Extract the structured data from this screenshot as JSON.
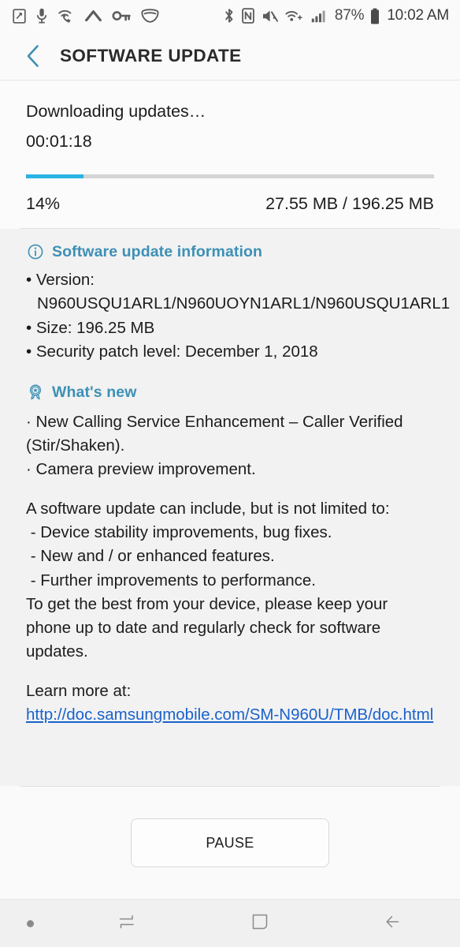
{
  "status_bar": {
    "left_icons": [
      {
        "name": "screenshot-capture-icon"
      },
      {
        "name": "microphone-recording-icon"
      },
      {
        "name": "wifi-calling-icon"
      },
      {
        "name": "caret-up-icon"
      },
      {
        "name": "vpn-key-icon"
      },
      {
        "name": "secure-shield-icon"
      }
    ],
    "right_icons": [
      {
        "name": "bluetooth-icon"
      },
      {
        "name": "nfc-icon"
      },
      {
        "name": "sound-mute-icon"
      },
      {
        "name": "wifi-icon"
      },
      {
        "name": "cellular-signal-icon"
      }
    ],
    "battery_percent": "87%",
    "battery_icon": "battery-full-icon",
    "clock": "10:02 AM"
  },
  "header": {
    "back_icon": "back-chevron-icon",
    "title": "SOFTWARE UPDATE",
    "accent_color": "#3d90b5"
  },
  "progress": {
    "status_text": "Downloading updates…",
    "elapsed_time": "00:01:18",
    "percent_label": "14%",
    "percent_value": 14,
    "bytes_label": "27.55 MB / 196.25 MB",
    "downloaded": "27.55 MB",
    "total": "196.25 MB",
    "fill_color": "#29b4e4",
    "track_color": "#d4d4d4"
  },
  "update_info": {
    "icon": "info-circle-icon",
    "heading": "Software update information",
    "items": [
      "• Version: N960USQU1ARL1/N960UOYN1ARL1/N960USQU1ARL1",
      "• Size: 196.25 MB",
      "• Security patch level: December 1, 2018"
    ],
    "version": "N960USQU1ARL1/N960UOYN1ARL1/N960USQU1ARL1",
    "size": "196.25 MB",
    "security_patch_level": "December 1, 2018"
  },
  "whats_new": {
    "icon": "award-badge-icon",
    "heading": "What's new",
    "highlights": "· New Calling Service Enhancement – Caller Verified (Stir/Shaken).\n· Camera preview improvement.",
    "description": "A software update can include, but is not limited to:\n - Device stability improvements, bug fixes.\n - New and / or enhanced features.\n - Further improvements to performance.\nTo get the best from your device, please keep your phone up to date and regularly check for software updates.",
    "learn_more_label": "Learn more at:",
    "learn_more_url": "http://doc.samsungmobile.com/SM-N960U/TMB/doc.html",
    "link_color": "#1a62cc"
  },
  "actions": {
    "pause_label": "PAUSE"
  },
  "nav_bar": {
    "dot_icon": "notification-dot-icon",
    "recents_icon": "recents-icon",
    "home_icon": "home-icon",
    "back_icon": "nav-back-icon"
  }
}
